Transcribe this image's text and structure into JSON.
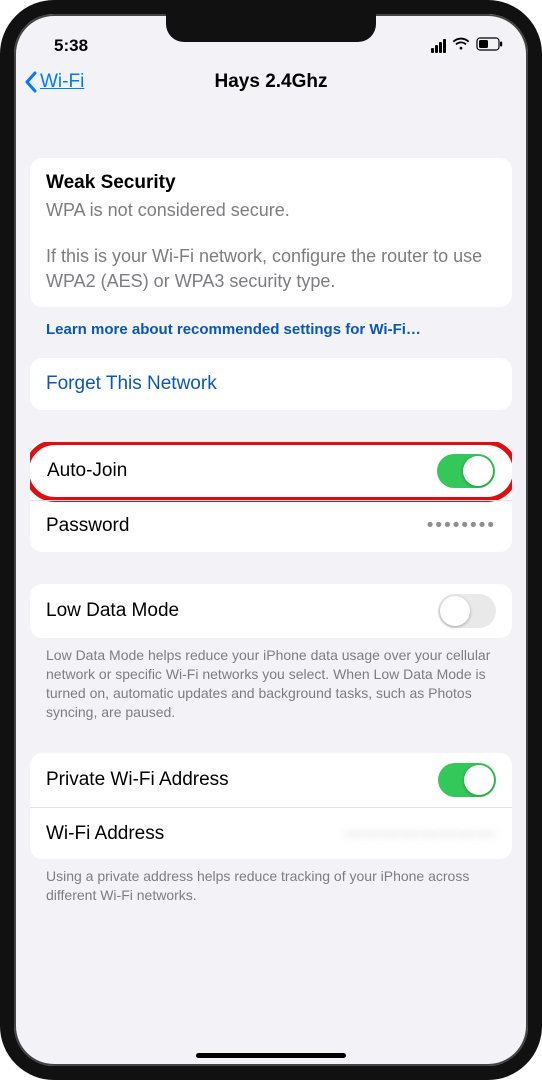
{
  "status": {
    "time": "5:38"
  },
  "nav": {
    "back": "Wi-Fi",
    "title": "Hays 2.4Ghz"
  },
  "security": {
    "title": "Weak Security",
    "subtitle": "WPA is not considered secure.",
    "body": "If this is your Wi-Fi network, configure the router to use WPA2 (AES) or WPA3 security type.",
    "learn_more": "Learn more about recommended settings for Wi-Fi…"
  },
  "forget": {
    "label": "Forget This Network"
  },
  "settings": {
    "auto_join": {
      "label": "Auto-Join",
      "on": true
    },
    "password": {
      "label": "Password",
      "value": "••••••••"
    }
  },
  "low_data": {
    "label": "Low Data Mode",
    "on": false,
    "footer": "Low Data Mode helps reduce your iPhone data usage over your cellular network or specific Wi-Fi networks you select. When Low Data Mode is turned on, automatic updates and background tasks, such as Photos syncing, are paused."
  },
  "private": {
    "private_label": "Private Wi-Fi Address",
    "private_on": true,
    "addr_label": "Wi-Fi Address",
    "addr_value": "————————",
    "footer": "Using a private address helps reduce tracking of your iPhone across different Wi-Fi networks."
  }
}
